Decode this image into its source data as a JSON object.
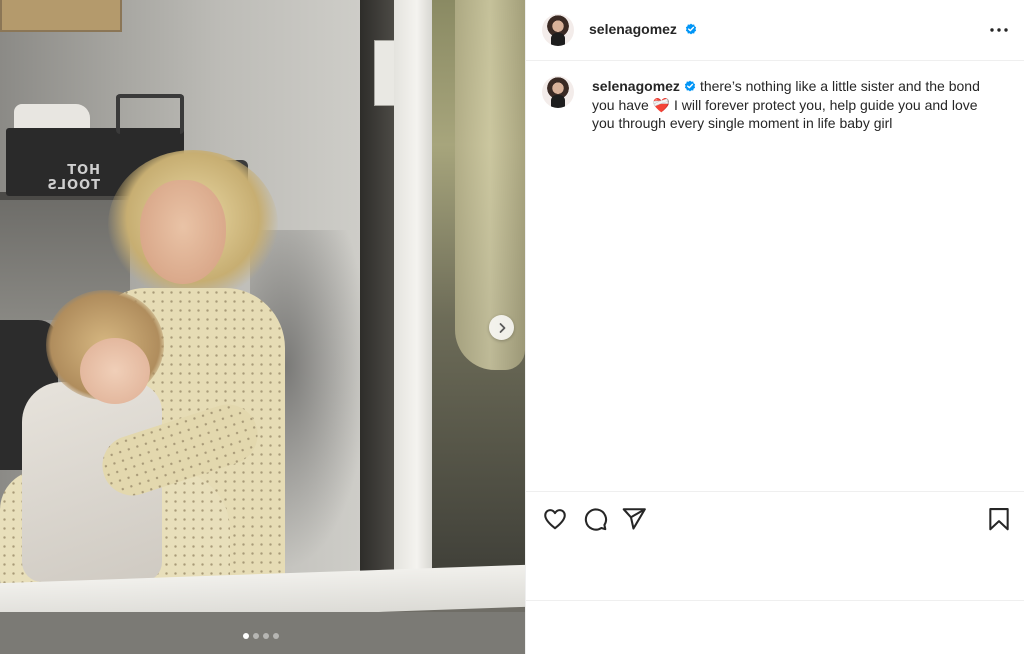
{
  "post": {
    "username": "selenagomez",
    "verified": true,
    "caption_text": "there’s nothing like a little sister and the bond you have ❤️‍🩹 I will forever protect you, help guide you and love you through every single moment in life baby girl",
    "photo_sign_text": "HOT TOOLS",
    "carousel": {
      "total": 4,
      "active_index": 0
    }
  },
  "icons": {
    "verified": "verified-badge-icon",
    "more": "more-options-icon",
    "next": "chevron-right-icon",
    "like": "heart-icon",
    "comment": "comment-icon",
    "share": "share-icon",
    "save": "bookmark-icon"
  },
  "colors": {
    "verified_blue": "#0095f6",
    "text": "#262626",
    "divider": "#efefef"
  }
}
